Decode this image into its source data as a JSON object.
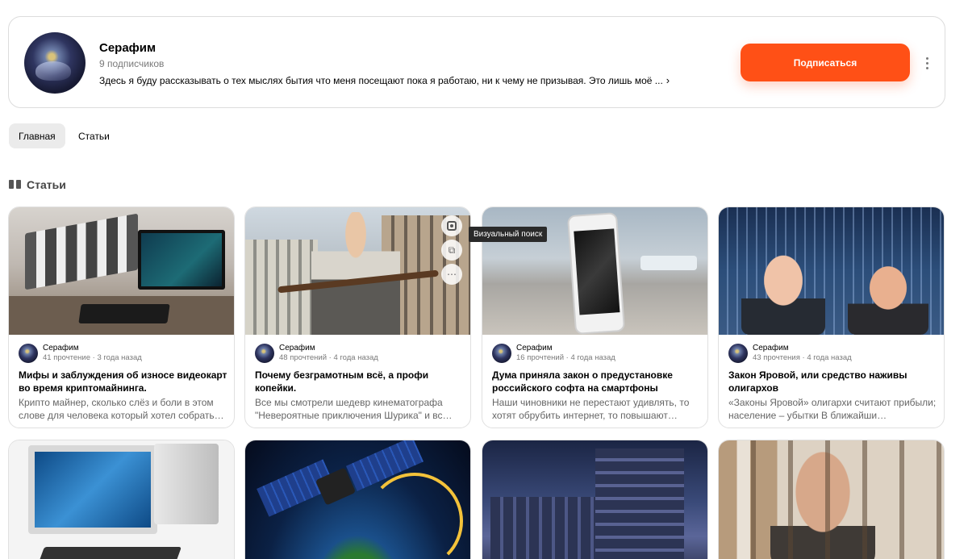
{
  "channel": {
    "name": "Серафим",
    "subscribers": "9 подписчиков",
    "description": "Здесь я буду рассказывать о тех мыслях бытия что меня посещают пока я работаю, ни к чему не призывая. Это лишь моё ...",
    "subscribe_label": "Подписаться"
  },
  "tabs": [
    {
      "label": "Главная",
      "active": true
    },
    {
      "label": "Статьи",
      "active": false
    }
  ],
  "section": {
    "title": "Статьи",
    "icon": "book-icon"
  },
  "tooltip": "Визуальный поиск",
  "articles": [
    {
      "author": "Серафим",
      "info": "41 прочтение · 3 года назад",
      "title": "Мифы и заблуждения об износе видеокарт во время криптомайнинга.",
      "snippet": "Крипто майнер, сколько слёз и боли в этом слове для человека который хотел собрать…"
    },
    {
      "author": "Серафим",
      "info": "48 прочтений · 4 года назад",
      "title": "Почему безграмотным всё, а профи копейки.",
      "snippet": "Все мы смотрели шедевр кинематографа \"Невероятные приключения Шурика\" и вс…"
    },
    {
      "author": "Серафим",
      "info": "16 прочтений · 4 года назад",
      "title": "Дума приняла закон о предустановке российского софта на смартфоны",
      "snippet": "Наши чиновники не перестают удивлять, то хотят обрубить интернет, то повышают…"
    },
    {
      "author": "Серафим",
      "info": "43 прочтения · 4 года назад",
      "title": "Закон Яровой, или средство наживы олигархов",
      "snippet": "«Законы Яровой» олигархи считают прибыли; население – убытки В ближайши…"
    }
  ],
  "colors": {
    "accent": "#ff5016",
    "tab_active_bg": "#ebebeb",
    "muted_text": "#7a7a7a"
  }
}
